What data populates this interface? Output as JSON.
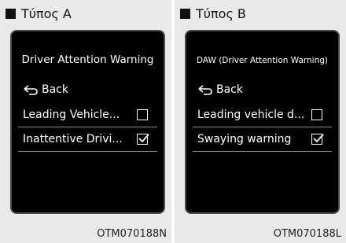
{
  "panels": [
    {
      "header": "Τύπος A",
      "screen_title": "Driver Attention Warning",
      "back_label": "Back",
      "items": [
        {
          "label": "Leading Vehicle...",
          "checked": false
        },
        {
          "label": "Inattentive Drivi...",
          "checked": true
        }
      ],
      "code": "OTM070188N"
    },
    {
      "header": "Τύπος B",
      "screen_title": "DAW (Driver Attention Warning)",
      "back_label": "Back",
      "items": [
        {
          "label": "Leading vehicle d...",
          "checked": false
        },
        {
          "label": "Swaying warning",
          "checked": true
        }
      ],
      "code": "OTM070188L"
    }
  ],
  "colors": {
    "panel_bg": "#e9e9e9",
    "screen_bg": "#000000",
    "text_on_screen": "#ffffff",
    "divider": "#8a8a8a"
  },
  "icons": {
    "header_marker": "black-square-icon",
    "back": "back-arrow-icon",
    "checkbox_empty": "checkbox-unchecked-icon",
    "checkbox_checked": "checkbox-checked-icon"
  }
}
